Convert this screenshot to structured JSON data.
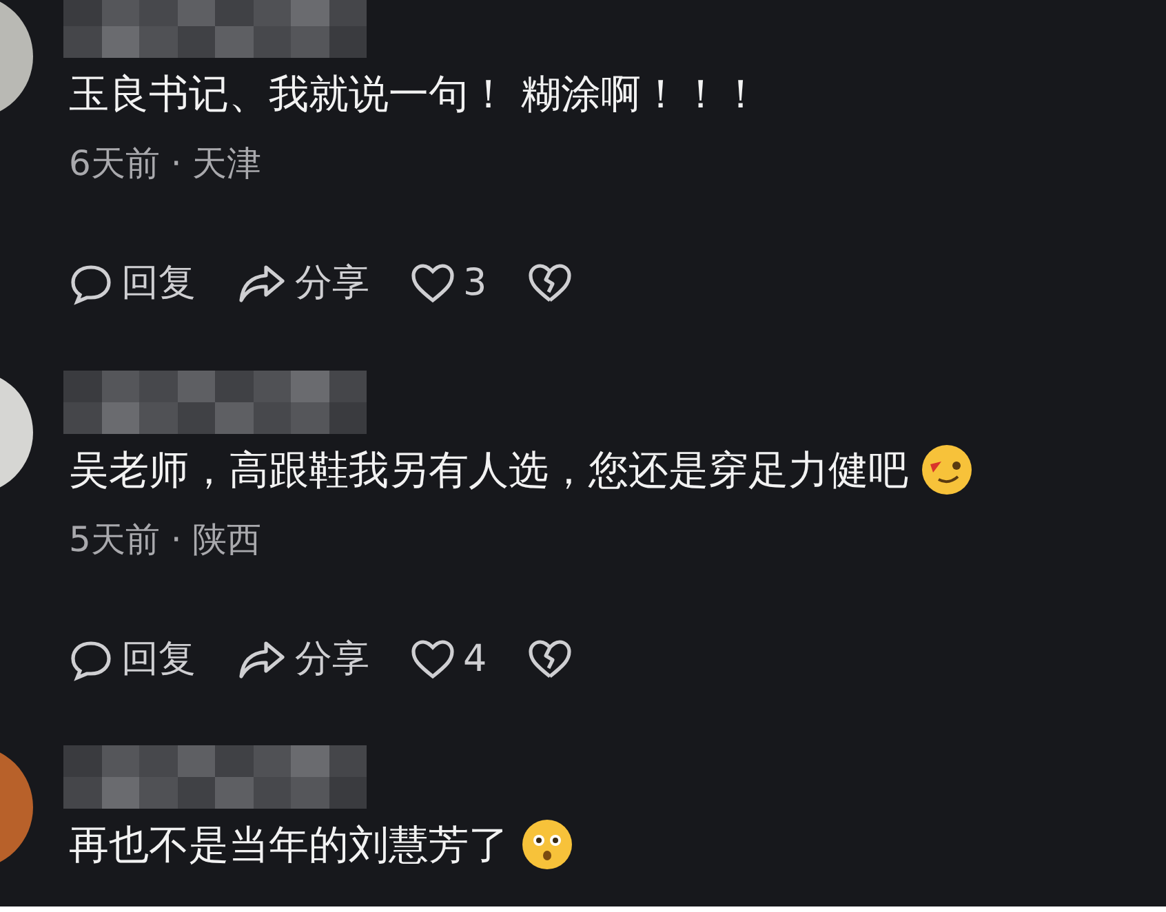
{
  "comments": [
    {
      "color": "#b9b9b4",
      "text": "玉良书记、我就说一句！ 糊涂啊！！！",
      "kind": "plain",
      "meta": "6天前 · 天津",
      "reply": "回复",
      "share": "分享",
      "likes": "3"
    },
    {
      "color": "#d6d6d3",
      "text": "吴老师，高跟鞋我另有人选，您还是穿足力健吧",
      "kind": "wink",
      "meta": "5天前 · 陕西",
      "reply": "回复",
      "share": "分享",
      "likes": "4"
    },
    {
      "color": "#b8612a",
      "text": "再也不是当年的刘慧芳了",
      "kind": "surprised"
    }
  ]
}
